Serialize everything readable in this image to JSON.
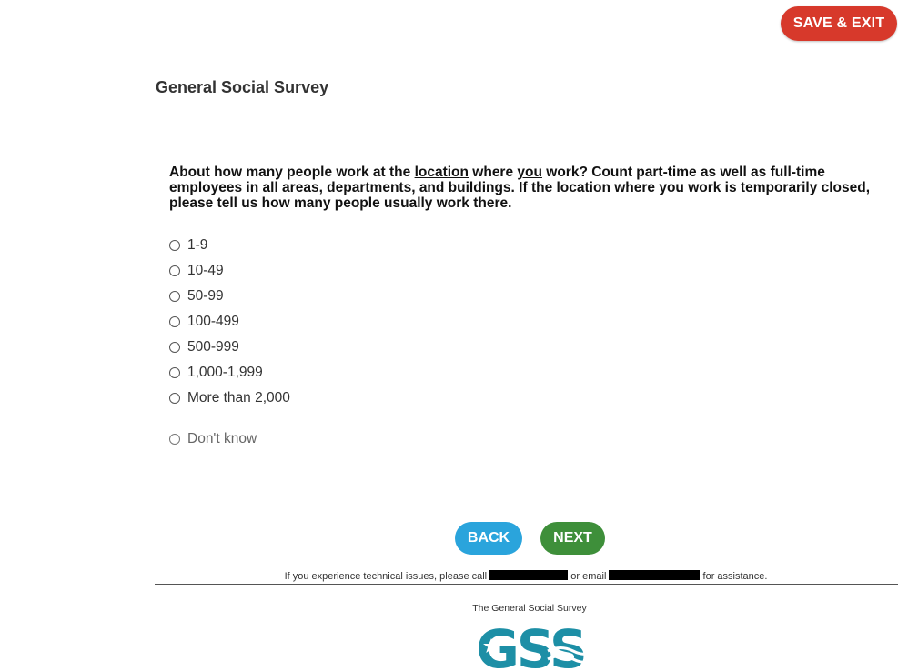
{
  "header": {
    "save_exit_label": "SAVE & EXIT"
  },
  "survey": {
    "title": "General Social Survey"
  },
  "question": {
    "part1": "About how many people work at the ",
    "link1": "location",
    "part2": " where ",
    "link2": "you",
    "part3": " work? Count part-time as well as full-time employees in all areas, departments, and buildings. If the location where you work is temporarily closed, please tell us how many people usually work there."
  },
  "options": [
    {
      "label": "1-9"
    },
    {
      "label": "10-49"
    },
    {
      "label": "50-99"
    },
    {
      "label": "100-499"
    },
    {
      "label": "500-999"
    },
    {
      "label": "1,000-1,999"
    },
    {
      "label": "More than 2,000"
    }
  ],
  "dont_know_label": "Don't know",
  "nav": {
    "back_label": "BACK",
    "next_label": "NEXT"
  },
  "footer": {
    "text1": "If you experience technical issues, please call",
    "text2": "or email",
    "text3": "for assistance."
  },
  "logo": {
    "caption": "The General Social Survey",
    "wordmark": "GSS"
  },
  "colors": {
    "save_exit": "#d7392b",
    "back": "#2aa4dc",
    "next": "#3e8f3a",
    "logo": "#1d8fa6"
  }
}
